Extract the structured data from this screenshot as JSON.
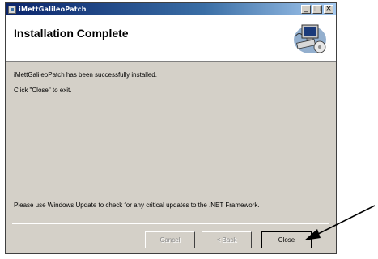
{
  "window": {
    "title": "iMettGalileoPatch",
    "controls": {
      "minimize": "_",
      "maximize": "□",
      "close": "×"
    }
  },
  "header": {
    "title": "Installation Complete",
    "graphic_icon": "computer-install-icon"
  },
  "body": {
    "line1": "iMettGalileoPatch has been successfully installed.",
    "line2": "Click \"Close\" to exit.",
    "update_note": "Please use Windows Update to check for any critical updates to the .NET Framework."
  },
  "buttons": {
    "cancel": "Cancel",
    "back": "< Back",
    "close": "Close"
  },
  "colors": {
    "dialog_bg": "#d4d0c8",
    "titlebar_start": "#0a246a",
    "titlebar_end": "#a6caf0"
  }
}
